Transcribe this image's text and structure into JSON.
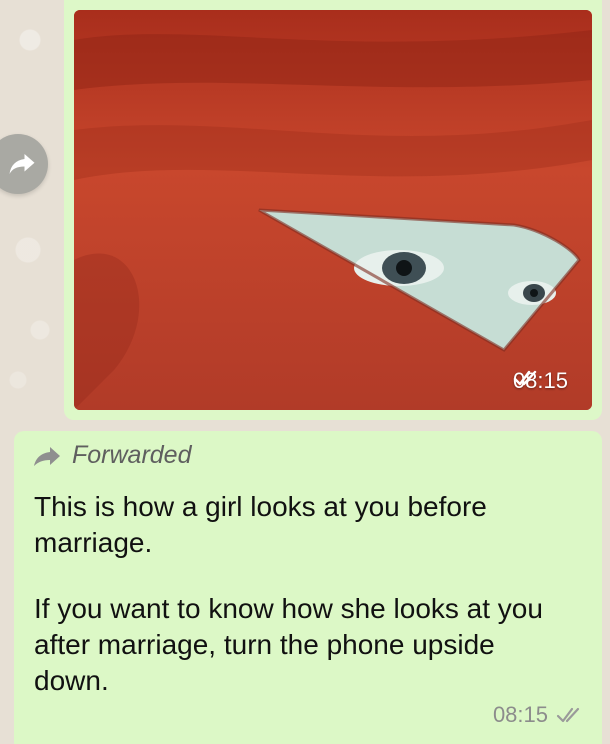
{
  "image_message": {
    "time": "08:15",
    "status_icon": "double-check-icon"
  },
  "text_message": {
    "forwarded_label": "Forwarded",
    "paragraph_1": "This is how a girl looks at you before marriage.",
    "paragraph_2": "If you want to know how she looks at you after marriage, turn the phone upside down.",
    "time": "08:15",
    "status_icon": "double-check-icon"
  },
  "colors": {
    "bubble": "#dcf8c6",
    "wallpaper": "#e7e0d5",
    "forward_button": "#a9a9a3"
  }
}
